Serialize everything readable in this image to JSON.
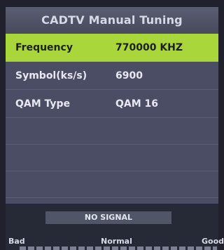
{
  "title": "CADTV Manual Tuning",
  "rows": [
    {
      "label": "Frequency",
      "value": "770000 KHZ",
      "selected": true
    },
    {
      "label": "Symbol(ks/s)",
      "value": "6900",
      "selected": false
    },
    {
      "label": "QAM Type",
      "value": "QAM 16",
      "selected": false
    }
  ],
  "status": {
    "signal_text": "NO SIGNAL"
  },
  "quality_scale": {
    "bad": "Bad",
    "normal": "Normal",
    "good": "Good"
  },
  "colors": {
    "selected_row": "#a9d63a",
    "list_background": "#4a4d63",
    "title_background": "#4e5164"
  }
}
